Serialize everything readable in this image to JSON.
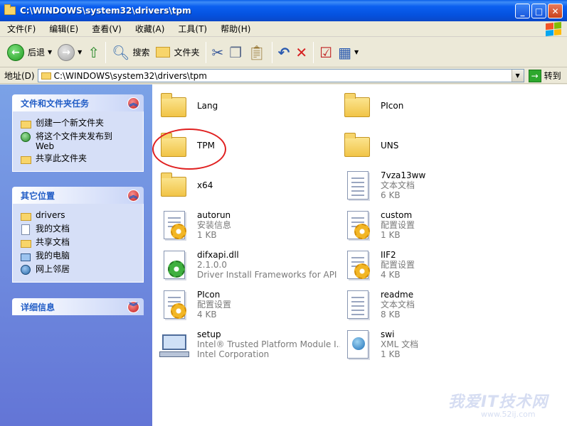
{
  "window": {
    "title": "C:\\WINDOWS\\system32\\drivers\\tpm"
  },
  "menu": [
    "文件(F)",
    "编辑(E)",
    "查看(V)",
    "收藏(A)",
    "工具(T)",
    "帮助(H)"
  ],
  "toolbar": {
    "back": "后退",
    "search": "搜索",
    "folders": "文件夹"
  },
  "address": {
    "label": "地址(D)",
    "path": "C:\\WINDOWS\\system32\\drivers\\tpm",
    "go": "转到"
  },
  "tasks_panel": {
    "title": "文件和文件夹任务",
    "items": [
      "创建一个新文件夹",
      "将这个文件夹发布到",
      "Web",
      "共享此文件夹"
    ]
  },
  "places_panel": {
    "title": "其它位置",
    "items": [
      "drivers",
      "我的文档",
      "共享文档",
      "我的电脑",
      "网上邻居"
    ]
  },
  "details_panel": {
    "title": "详细信息"
  },
  "files": [
    {
      "name": "Lang",
      "type": "folder"
    },
    {
      "name": "PIcon",
      "type": "folder"
    },
    {
      "name": "TPM",
      "type": "folder"
    },
    {
      "name": "UNS",
      "type": "folder"
    },
    {
      "name": "x64",
      "type": "folder"
    },
    {
      "name": "7vza13ww",
      "sub1": "文本文档",
      "sub2": "6 KB",
      "type": "text"
    },
    {
      "name": "autorun",
      "sub1": "安装信息",
      "sub2": "1 KB",
      "type": "config"
    },
    {
      "name": "custom",
      "sub1": "配置设置",
      "sub2": "1 KB",
      "type": "config"
    },
    {
      "name": "difxapi.dll",
      "sub1": "2.1.0.0",
      "sub2": "Driver Install Frameworks for API li...",
      "type": "dll"
    },
    {
      "name": "IIF2",
      "sub1": "配置设置",
      "sub2": "4 KB",
      "type": "config"
    },
    {
      "name": "PIcon",
      "sub1": "配置设置",
      "sub2": "4 KB",
      "type": "config"
    },
    {
      "name": "readme",
      "sub1": "文本文档",
      "sub2": "8 KB",
      "type": "text"
    },
    {
      "name": "setup",
      "sub1": "Intel® Trusted Platform Module I...",
      "sub2": "Intel Corporation",
      "type": "setup"
    },
    {
      "name": "swi",
      "sub1": "XML 文档",
      "sub2": "1 KB",
      "type": "xml"
    }
  ],
  "watermark": {
    "main": "我爱IT技术网",
    "sub": "www.52ij.com"
  }
}
